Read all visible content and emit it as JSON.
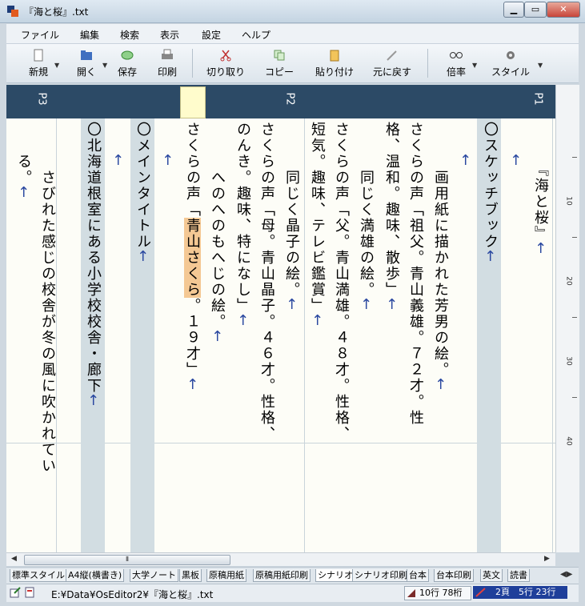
{
  "window": {
    "title": "『海と桜』.txt"
  },
  "menu": [
    "ファイル",
    "編集",
    "検索",
    "表示",
    "設定",
    "ヘルプ"
  ],
  "toolbar": [
    {
      "label": "新規",
      "icon": "new-document-icon"
    },
    {
      "label": "開く",
      "icon": "open-folder-icon"
    },
    {
      "label": "保存",
      "icon": "save-icon"
    },
    {
      "label": "印刷",
      "icon": "print-icon"
    },
    {
      "label": "切り取り",
      "icon": "scissors-icon"
    },
    {
      "label": "コピー",
      "icon": "copy-icon"
    },
    {
      "label": "貼り付け",
      "icon": "paste-icon"
    },
    {
      "label": "元に戻す",
      "icon": "undo-icon"
    },
    {
      "label": "倍率",
      "icon": "glasses-icon"
    },
    {
      "label": "スタイル",
      "icon": "gear-icon"
    }
  ],
  "pages": [
    "P1",
    "P2",
    "P3"
  ],
  "editor": {
    "columns": [
      "『海と桜』",
      "",
      "〇スケッチブック",
      "　画用紙に描かれた芳男の絵。",
      "さくらの声「祖父。青山義雄。７２才。性格、温和。趣味、散歩」",
      "　同じく満雄の絵。",
      "さくらの声「父。青山満雄。４８才。性格、短気。趣味、テレビ鑑賞」",
      "　同じく晶子の絵。",
      "さくらの声「母。青山晶子。４６才。性格、のんき。趣味、特になし」",
      "　へのへのもへじの絵。",
      "さくらの声「",
      "",
      "〇メインタイトル",
      "",
      "〇北海道根室にある小学校校舎・廊下",
      "　さびれた感じの校舎が冬の風に吹かれている。"
    ],
    "highlight_word": "青山さくら",
    "line_after_highlight": "。１９才」",
    "return_mark": "←"
  },
  "ruler": [
    "10",
    "20",
    "30",
    "40"
  ],
  "style_tabs": [
    "標準スタイル",
    "A4縦(横書き)",
    "大学ノート",
    "黒板",
    "原稿用紙",
    "原稿用紙印刷",
    "シナリオ",
    "シナリオ印刷",
    "台本",
    "台本印刷",
    "英文",
    "読書"
  ],
  "active_style_tab": "シナリオ",
  "status": {
    "path": "E:¥Data¥OsEditor2¥『海と桜』.txt",
    "lines": "10行 78桁",
    "position": "2頁　5行 23行"
  },
  "colors": {
    "accent": "#2c4a66",
    "highlight": "#f4c894",
    "column_band": "#d2dde2",
    "return_mark": "#2a48a0"
  }
}
